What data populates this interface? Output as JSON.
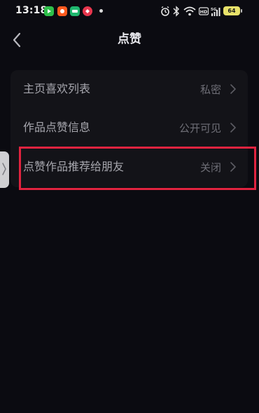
{
  "status_bar": {
    "time": "13:18",
    "battery_level": "64",
    "network_label": "5G",
    "hd_label": "HD",
    "app_icons": [
      "app-icon-green",
      "app-icon-orange",
      "app-icon-teal",
      "app-icon-red"
    ]
  },
  "header": {
    "title": "点赞",
    "back_icon": "chevron-left-icon"
  },
  "settings": {
    "rows": [
      {
        "label": "主页喜欢列表",
        "value": "私密"
      },
      {
        "label": "作品点赞信息",
        "value": "公开可见"
      },
      {
        "label": "点赞作品推荐给朋友",
        "value": "关闭"
      }
    ]
  },
  "colors": {
    "background": "#0b0b11",
    "card": "#131318",
    "highlight": "#e0233f",
    "battery": "#e8e26a"
  }
}
